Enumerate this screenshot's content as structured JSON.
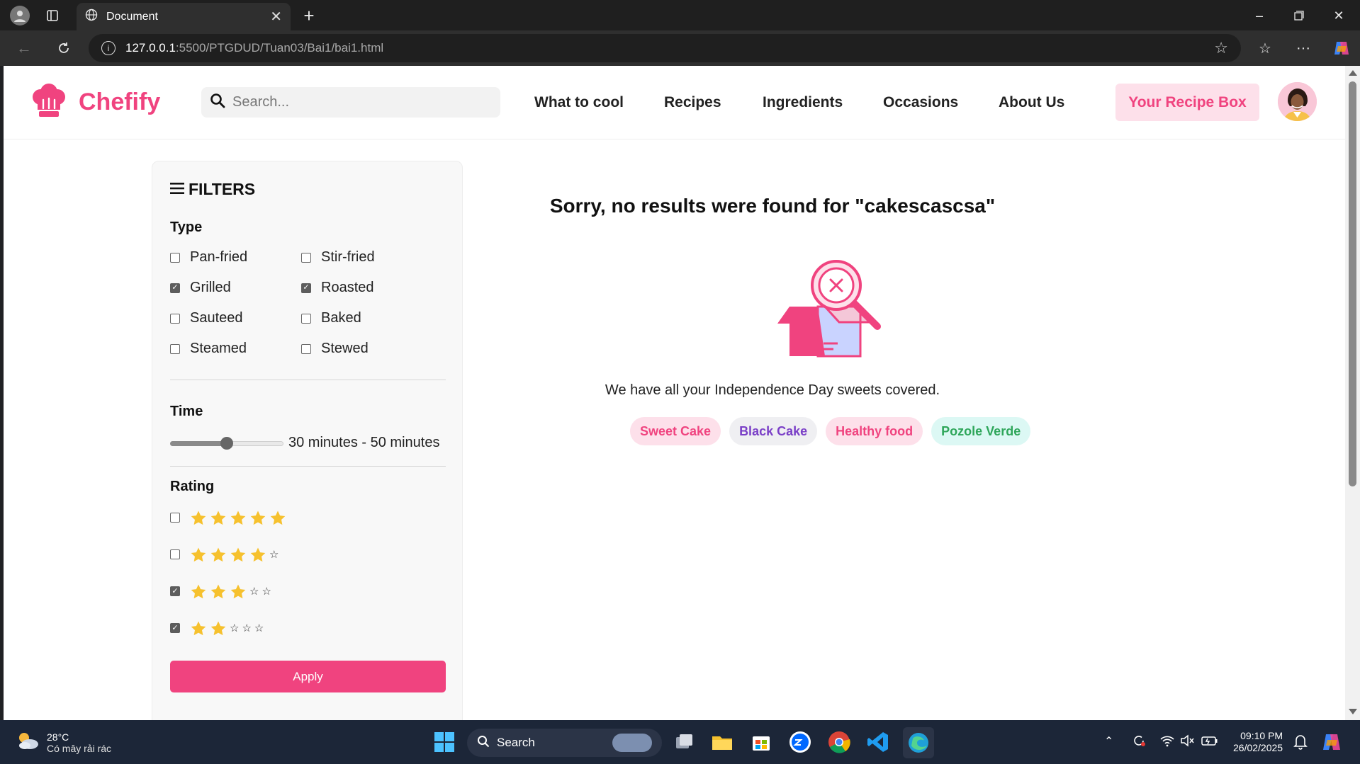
{
  "browser": {
    "tab_title": "Document",
    "url_host": "127.0.0.1",
    "url_path": ":5500/PTGDUD/Tuan03/Bai1/bai1.html"
  },
  "header": {
    "logo_text": "Chefify",
    "search_placeholder": "Search...",
    "nav": [
      "What to cool",
      "Recipes",
      "Ingredients",
      "Occasions",
      "About Us"
    ],
    "recipe_box_label": "Your Recipe Box"
  },
  "filters": {
    "title": "FILTERS",
    "type_title": "Type",
    "types": [
      {
        "label": "Pan-fried",
        "checked": false
      },
      {
        "label": "Stir-fried",
        "checked": false
      },
      {
        "label": "Grilled",
        "checked": true
      },
      {
        "label": "Roasted",
        "checked": true
      },
      {
        "label": "Sauteed",
        "checked": false
      },
      {
        "label": "Baked",
        "checked": false
      },
      {
        "label": "Steamed",
        "checked": false
      },
      {
        "label": "Stewed",
        "checked": false
      }
    ],
    "time_title": "Time",
    "time_range_text": "30 minutes - 50 minutes",
    "time_slider_fraction": 0.5,
    "rating_title": "Rating",
    "ratings": [
      {
        "stars": 5,
        "checked": false
      },
      {
        "stars": 4,
        "checked": false
      },
      {
        "stars": 3,
        "checked": true
      },
      {
        "stars": 2,
        "checked": true
      }
    ],
    "apply_label": "Apply"
  },
  "result": {
    "title": "Sorry, no results were found for \"cakescascsa\"",
    "subtitle": "We have all your Independence Day sweets covered.",
    "tags": [
      {
        "label": "Sweet Cake",
        "color": "#f0437f",
        "bg": "#fde0ea"
      },
      {
        "label": "Black Cake",
        "color": "#7a3fc7",
        "bg": "#efeff2"
      },
      {
        "label": "Healthy food",
        "color": "#f0437f",
        "bg": "#fde0ea"
      },
      {
        "label": "Pozole Verde",
        "color": "#2ea65a",
        "bg": "#dcf8f4"
      }
    ]
  },
  "taskbar": {
    "temperature": "28°C",
    "weather_text": "Có mây rải rác",
    "search_label": "Search",
    "time": "09:10 PM",
    "date": "26/02/2025"
  },
  "colors": {
    "accent": "#f0437f",
    "accent_light": "#fde0ea"
  }
}
